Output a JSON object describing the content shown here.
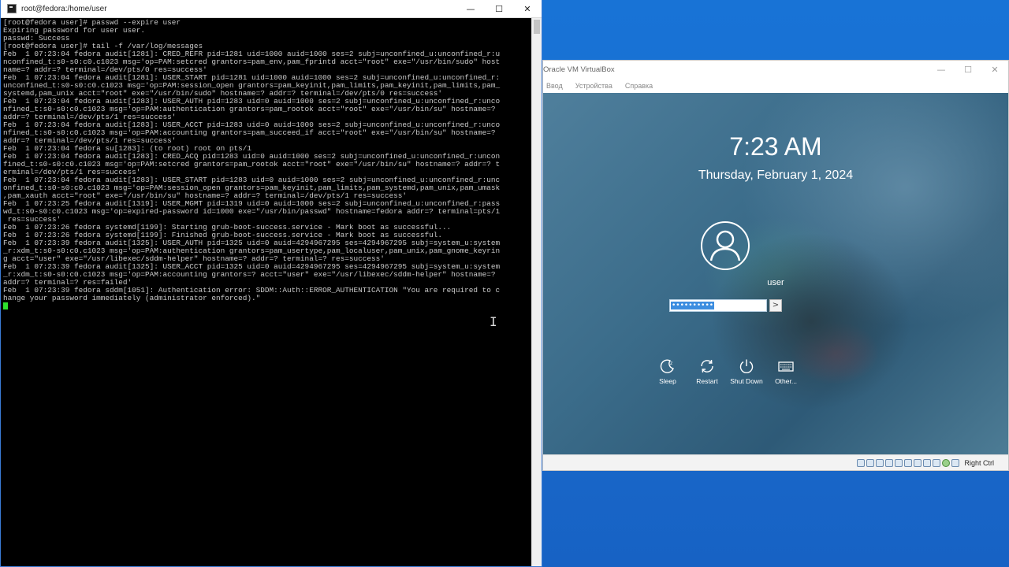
{
  "terminal": {
    "title": "root@fedora:/home/user",
    "controls": {
      "minimize": "—",
      "maximize": "☐",
      "close": "✕"
    },
    "lines": [
      "[root@fedora user]# passwd --expire user",
      "Expiring password for user user.",
      "passwd: Success",
      "[root@fedora user]# tail -f /var/log/messages",
      "Feb  1 07:23:04 fedora audit[1281]: CRED_REFR pid=1281 uid=1000 auid=1000 ses=2 subj=unconfined_u:unconfined_r:u",
      "nconfined_t:s0-s0:c0.c1023 msg='op=PAM:setcred grantors=pam_env,pam_fprintd acct=\"root\" exe=\"/usr/bin/sudo\" host",
      "name=? addr=? terminal=/dev/pts/0 res=success'",
      "Feb  1 07:23:04 fedora audit[1281]: USER_START pid=1281 uid=1000 auid=1000 ses=2 subj=unconfined_u:unconfined_r:",
      "unconfined_t:s0-s0:c0.c1023 msg='op=PAM:session_open grantors=pam_keyinit,pam_limits,pam_keyinit,pam_limits,pam_",
      "systemd,pam_unix acct=\"root\" exe=\"/usr/bin/sudo\" hostname=? addr=? terminal=/dev/pts/0 res=success'",
      "Feb  1 07:23:04 fedora audit[1283]: USER_AUTH pid=1283 uid=0 auid=1000 ses=2 subj=unconfined_u:unconfined_r:unco",
      "nfined_t:s0-s0:c0.c1023 msg='op=PAM:authentication grantors=pam_rootok acct=\"root\" exe=\"/usr/bin/su\" hostname=?",
      "addr=? terminal=/dev/pts/1 res=success'",
      "Feb  1 07:23:04 fedora audit[1283]: USER_ACCT pid=1283 uid=0 auid=1000 ses=2 subj=unconfined_u:unconfined_r:unco",
      "nfined_t:s0-s0:c0.c1023 msg='op=PAM:accounting grantors=pam_succeed_if acct=\"root\" exe=\"/usr/bin/su\" hostname=?",
      "addr=? terminal=/dev/pts/1 res=success'",
      "Feb  1 07:23:04 fedora su[1283]: (to root) root on pts/1",
      "Feb  1 07:23:04 fedora audit[1283]: CRED_ACQ pid=1283 uid=0 auid=1000 ses=2 subj=unconfined_u:unconfined_r:uncon",
      "fined_t:s0-s0:c0.c1023 msg='op=PAM:setcred grantors=pam_rootok acct=\"root\" exe=\"/usr/bin/su\" hostname=? addr=? t",
      "erminal=/dev/pts/1 res=success'",
      "Feb  1 07:23:04 fedora audit[1283]: USER_START pid=1283 uid=0 auid=1000 ses=2 subj=unconfined_u:unconfined_r:unc",
      "onfined_t:s0-s0:c0.c1023 msg='op=PAM:session_open grantors=pam_keyinit,pam_limits,pam_systemd,pam_unix,pam_umask",
      ",pam_xauth acct=\"root\" exe=\"/usr/bin/su\" hostname=? addr=? terminal=/dev/pts/1 res=success'",
      "Feb  1 07:23:25 fedora audit[1319]: USER_MGMT pid=1319 uid=0 auid=1000 ses=2 subj=unconfined_u:unconfined_r:pass",
      "wd_t:s0-s0:c0.c1023 msg='op=expired-password id=1000 exe=\"/usr/bin/passwd\" hostname=fedora addr=? terminal=pts/1",
      " res=success'",
      "Feb  1 07:23:26 fedora systemd[1199]: Starting grub-boot-success.service - Mark boot as successful...",
      "Feb  1 07:23:26 fedora systemd[1199]: Finished grub-boot-success.service - Mark boot as successful.",
      "Feb  1 07:23:39 fedora audit[1325]: USER_AUTH pid=1325 uid=0 auid=4294967295 ses=4294967295 subj=system_u:system",
      "_r:xdm_t:s0-s0:c0.c1023 msg='op=PAM:authentication grantors=pam_usertype,pam_localuser,pam_unix,pam_gnome_keyrin",
      "g acct=\"user\" exe=\"/usr/libexec/sddm-helper\" hostname=? addr=? terminal=? res=success'",
      "Feb  1 07:23:39 fedora audit[1325]: USER_ACCT pid=1325 uid=0 auid=4294967295 ses=4294967295 subj=system_u:system",
      "_r:xdm_t:s0-s0:c0.c1023 msg='op=PAM:accounting grantors=? acct=\"user\" exe=\"/usr/libexec/sddm-helper\" hostname=?",
      "addr=? terminal=? res=failed'",
      "Feb  1 07:23:39 fedora sddm[1051]: Authentication error: SDDM::Auth::ERROR_AUTHENTICATION \"You are required to c",
      "hange your password immediately (administrator enforced).\""
    ]
  },
  "vbox": {
    "title": "Oracle VM VirtualBox",
    "controls": {
      "minimize": "—",
      "maximize": "☐",
      "close": "✕"
    },
    "menu": [
      "Ввод",
      "Устройства",
      "Справка"
    ],
    "host_key": "Right Ctrl",
    "status_icons": [
      "hdd-icon",
      "optical-icon",
      "audio-icon",
      "network-icon",
      "usb-icon",
      "shared-folder-icon",
      "display-icon",
      "recording-icon",
      "cpu-icon",
      "mouse-integration-icon",
      "keyboard-icon"
    ]
  },
  "login": {
    "time": "7:23 AM",
    "date": "Thursday, February 1, 2024",
    "username": "user",
    "password_value": "••••••••••",
    "go_label": ">",
    "actions": [
      {
        "name": "sleep",
        "label": "Sleep"
      },
      {
        "name": "restart",
        "label": "Restart"
      },
      {
        "name": "shut-down",
        "label": "Shut Down"
      },
      {
        "name": "other",
        "label": "Other..."
      }
    ]
  }
}
